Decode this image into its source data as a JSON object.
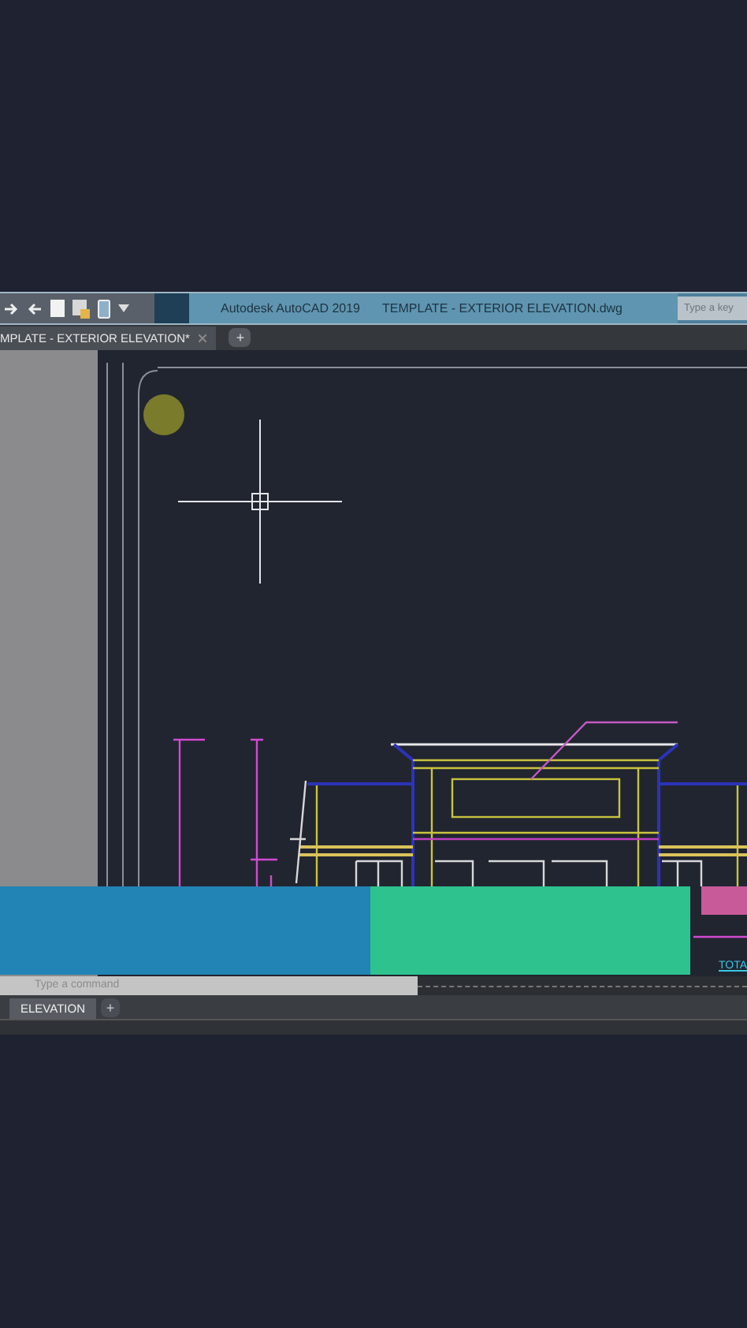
{
  "window": {
    "app_title": "Autodesk AutoCAD 2019",
    "file_title": "TEMPLATE - EXTERIOR ELEVATION.dwg",
    "search": {
      "placeholder": "Type a key"
    }
  },
  "file_tabs": [
    {
      "label": "MPLATE - EXTERIOR ELEVATION*",
      "selected": true
    }
  ],
  "new_tab_button": "+",
  "drawing": {
    "total_label": "TOTA"
  },
  "command_line": {
    "placeholder": "Type a command"
  },
  "layout_tabs": [
    {
      "label": "ELEVATION",
      "selected": true
    }
  ],
  "new_layout_button": "+"
}
